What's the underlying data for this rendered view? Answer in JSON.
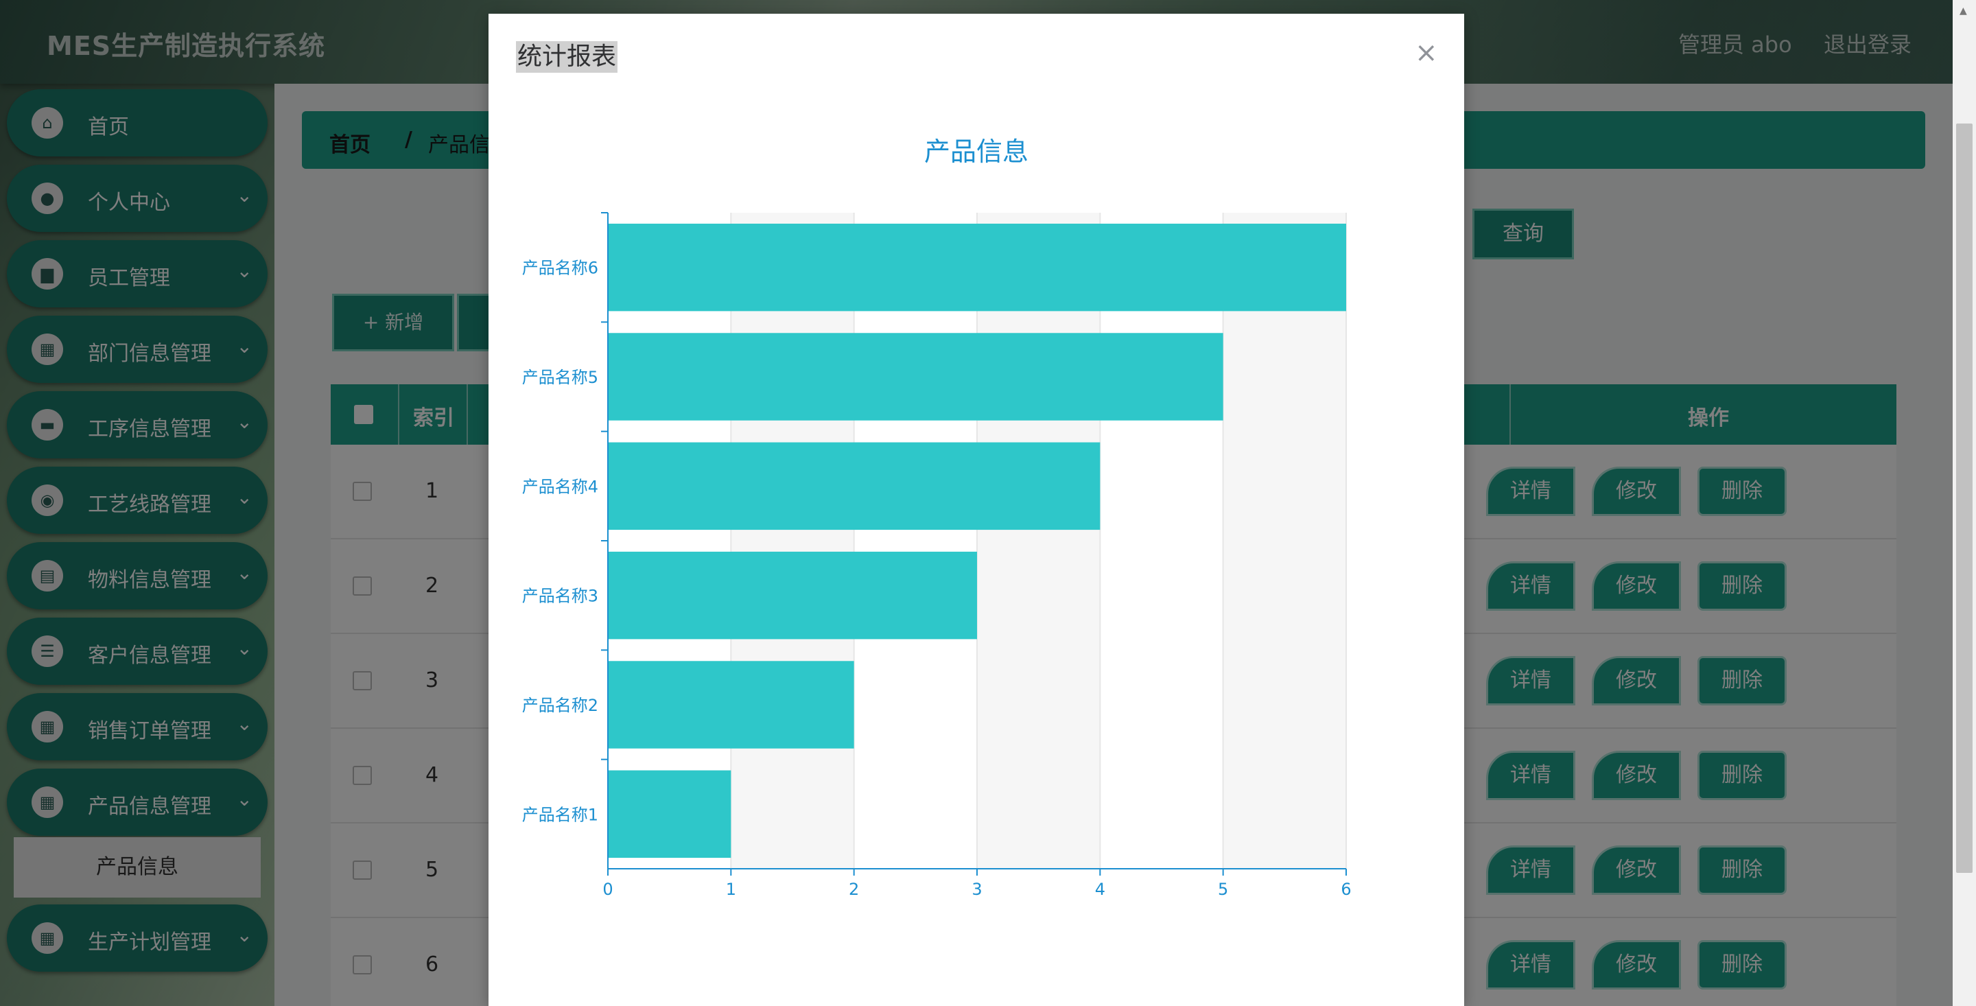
{
  "app": {
    "title": "MES生产制造执行系统",
    "admin_label": "管理员 abo",
    "logout_label": "退出登录"
  },
  "sidebar": {
    "items": [
      {
        "label": "首页",
        "icon": "home-icon",
        "glyph": "⌂",
        "chevron": ""
      },
      {
        "label": "个人中心",
        "icon": "user-icon",
        "glyph": "●",
        "chevron": "⌄"
      },
      {
        "label": "员工管理",
        "icon": "badge-icon",
        "glyph": "▆",
        "chevron": "⌄"
      },
      {
        "label": "部门信息管理",
        "icon": "grid-icon",
        "glyph": "▦",
        "chevron": "⌄"
      },
      {
        "label": "工序信息管理",
        "icon": "chat-icon",
        "glyph": "▬",
        "chevron": "⌄"
      },
      {
        "label": "工艺线路管理",
        "icon": "bulb-icon",
        "glyph": "◉",
        "chevron": "⌄"
      },
      {
        "label": "物料信息管理",
        "icon": "clipboard-icon",
        "glyph": "▤",
        "chevron": "⌄"
      },
      {
        "label": "客户信息管理",
        "icon": "sliders-icon",
        "glyph": "☰",
        "chevron": "⌄"
      },
      {
        "label": "销售订单管理",
        "icon": "grid-icon",
        "glyph": "▦",
        "chevron": "⌄"
      },
      {
        "label": "产品信息管理",
        "icon": "grid-icon",
        "glyph": "▦",
        "chevron": "⌄"
      },
      {
        "label": "生产计划管理",
        "icon": "grid-icon",
        "glyph": "▦",
        "chevron": "⌄"
      }
    ],
    "active_sub": "产品信息"
  },
  "breadcrumb": {
    "home": "首页",
    "sep": "/",
    "current": "产品信息"
  },
  "toolbar": {
    "query_label": "查询",
    "add_label": "+ 新增"
  },
  "table": {
    "index_header": "索引",
    "op_header": "操作",
    "rows": [
      "1",
      "2",
      "3",
      "4",
      "5",
      "6"
    ],
    "detail_label": "详情",
    "edit_label": "修改",
    "delete_label": "删除"
  },
  "modal": {
    "title": "统计报表",
    "close_glyph": "×"
  },
  "colors": {
    "bar": "#2ec7c9",
    "axis": "#1c8fd0",
    "title": "#1c8fd0",
    "theme": "#1fa08a"
  },
  "chart_data": {
    "type": "bar",
    "orientation": "horizontal",
    "title": "产品信息",
    "categories": [
      "产品名称1",
      "产品名称2",
      "产品名称3",
      "产品名称4",
      "产品名称5",
      "产品名称6"
    ],
    "values": [
      1,
      2,
      3,
      4,
      5,
      6
    ],
    "xlim": [
      0,
      6
    ],
    "xticks": [
      0,
      1,
      2,
      3,
      4,
      5,
      6
    ],
    "xlabel": "",
    "ylabel": "",
    "grid": true
  }
}
